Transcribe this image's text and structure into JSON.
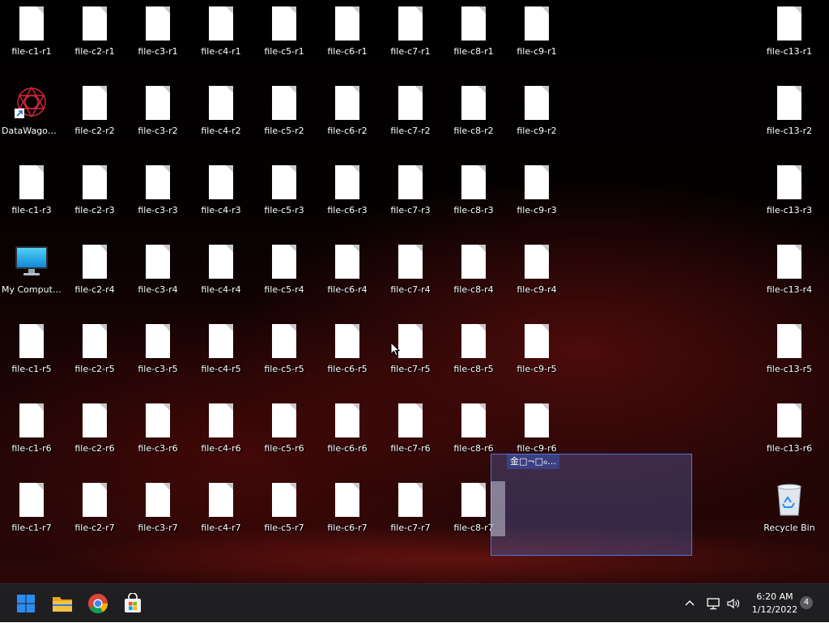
{
  "desktop": {
    "icons": [
      {
        "label": "file-c1-r1",
        "kind": "file"
      },
      {
        "label": "DataWagon…",
        "kind": "shortcut-app"
      },
      {
        "label": "file-c1-r3",
        "kind": "file"
      },
      {
        "label": "My Computer",
        "kind": "my-computer"
      },
      {
        "label": "file-c1-r5",
        "kind": "file"
      },
      {
        "label": "file-c1-r6",
        "kind": "file"
      },
      {
        "label": "file-c1-r7",
        "kind": "file"
      },
      {
        "label": "file-c2-r1",
        "kind": "file"
      },
      {
        "label": "file-c2-r2",
        "kind": "file"
      },
      {
        "label": "file-c2-r3",
        "kind": "file"
      },
      {
        "label": "file-c2-r4",
        "kind": "file"
      },
      {
        "label": "file-c2-r5",
        "kind": "file"
      },
      {
        "label": "file-c2-r6",
        "kind": "file"
      },
      {
        "label": "file-c2-r7",
        "kind": "file"
      },
      {
        "label": "file-c3-r1",
        "kind": "file"
      },
      {
        "label": "file-c3-r2",
        "kind": "file"
      },
      {
        "label": "file-c3-r3",
        "kind": "file"
      },
      {
        "label": "file-c3-r4",
        "kind": "file"
      },
      {
        "label": "file-c3-r5",
        "kind": "file"
      },
      {
        "label": "file-c3-r6",
        "kind": "file"
      },
      {
        "label": "file-c3-r7",
        "kind": "file"
      },
      {
        "label": "file-c4-r1",
        "kind": "file"
      },
      {
        "label": "file-c4-r2",
        "kind": "file"
      },
      {
        "label": "file-c4-r3",
        "kind": "file"
      },
      {
        "label": "file-c4-r4",
        "kind": "file"
      },
      {
        "label": "file-c4-r5",
        "kind": "file"
      },
      {
        "label": "file-c4-r6",
        "kind": "file"
      },
      {
        "label": "file-c4-r7",
        "kind": "file"
      },
      {
        "label": "file-c5-r1",
        "kind": "file"
      },
      {
        "label": "file-c5-r2",
        "kind": "file"
      },
      {
        "label": "file-c5-r3",
        "kind": "file"
      },
      {
        "label": "file-c5-r4",
        "kind": "file"
      },
      {
        "label": "file-c5-r5",
        "kind": "file"
      },
      {
        "label": "file-c5-r6",
        "kind": "file"
      },
      {
        "label": "file-c5-r7",
        "kind": "file"
      },
      {
        "label": "file-c6-r1",
        "kind": "file"
      },
      {
        "label": "file-c6-r2",
        "kind": "file"
      },
      {
        "label": "file-c6-r3",
        "kind": "file"
      },
      {
        "label": "file-c6-r4",
        "kind": "file"
      },
      {
        "label": "file-c6-r5",
        "kind": "file"
      },
      {
        "label": "file-c6-r6",
        "kind": "file"
      },
      {
        "label": "file-c6-r7",
        "kind": "file"
      },
      {
        "label": "file-c7-r1",
        "kind": "file"
      },
      {
        "label": "file-c7-r2",
        "kind": "file"
      },
      {
        "label": "file-c7-r3",
        "kind": "file"
      },
      {
        "label": "file-c7-r4",
        "kind": "file"
      },
      {
        "label": "file-c7-r5",
        "kind": "file"
      },
      {
        "label": "file-c7-r6",
        "kind": "file"
      },
      {
        "label": "file-c7-r7",
        "kind": "file"
      },
      {
        "label": "file-c8-r1",
        "kind": "file"
      },
      {
        "label": "file-c8-r2",
        "kind": "file"
      },
      {
        "label": "file-c8-r3",
        "kind": "file"
      },
      {
        "label": "file-c8-r4",
        "kind": "file"
      },
      {
        "label": "file-c8-r5",
        "kind": "file"
      },
      {
        "label": "file-c8-r6",
        "kind": "file"
      },
      {
        "label": "file-c8-r7",
        "kind": "file"
      },
      {
        "label": "file-c9-r1",
        "kind": "file"
      },
      {
        "label": "file-c9-r2",
        "kind": "file"
      },
      {
        "label": "file-c9-r3",
        "kind": "file"
      },
      {
        "label": "file-c9-r4",
        "kind": "file"
      },
      {
        "label": "file-c9-r5",
        "kind": "file"
      },
      {
        "label": "file-c9-r6",
        "kind": "file"
      },
      {
        "label": "file-c13-r1",
        "kind": "file"
      },
      {
        "label": "file-c13-r2",
        "kind": "file"
      },
      {
        "label": "file-c13-r3",
        "kind": "file"
      },
      {
        "label": "file-c13-r4",
        "kind": "file"
      },
      {
        "label": "file-c13-r5",
        "kind": "file"
      },
      {
        "label": "file-c13-r6",
        "kind": "file"
      },
      {
        "label": "Recycle Bin",
        "kind": "recycle-bin"
      }
    ],
    "selection": {
      "label": "金□¬□ℴ…"
    }
  },
  "taskbar": {
    "pinned": [
      {
        "name": "start",
        "icon": "windows-logo-icon"
      },
      {
        "name": "file-explorer",
        "icon": "folder-icon"
      },
      {
        "name": "chrome",
        "icon": "chrome-icon"
      },
      {
        "name": "store",
        "icon": "store-icon"
      }
    ],
    "tray": {
      "overflow_icon": "chevron-up-icon",
      "network_icon": "network-icon",
      "volume_icon": "volume-icon"
    },
    "clock": {
      "time": "6:20 AM",
      "date": "1/12/2022"
    },
    "notifications": "4"
  },
  "colors": {
    "taskbar_bg": "#1f1f22",
    "selection_border": "#4a76d8",
    "windows_blue": "#2b8cf0",
    "folder_yellow": "#f3c244"
  }
}
